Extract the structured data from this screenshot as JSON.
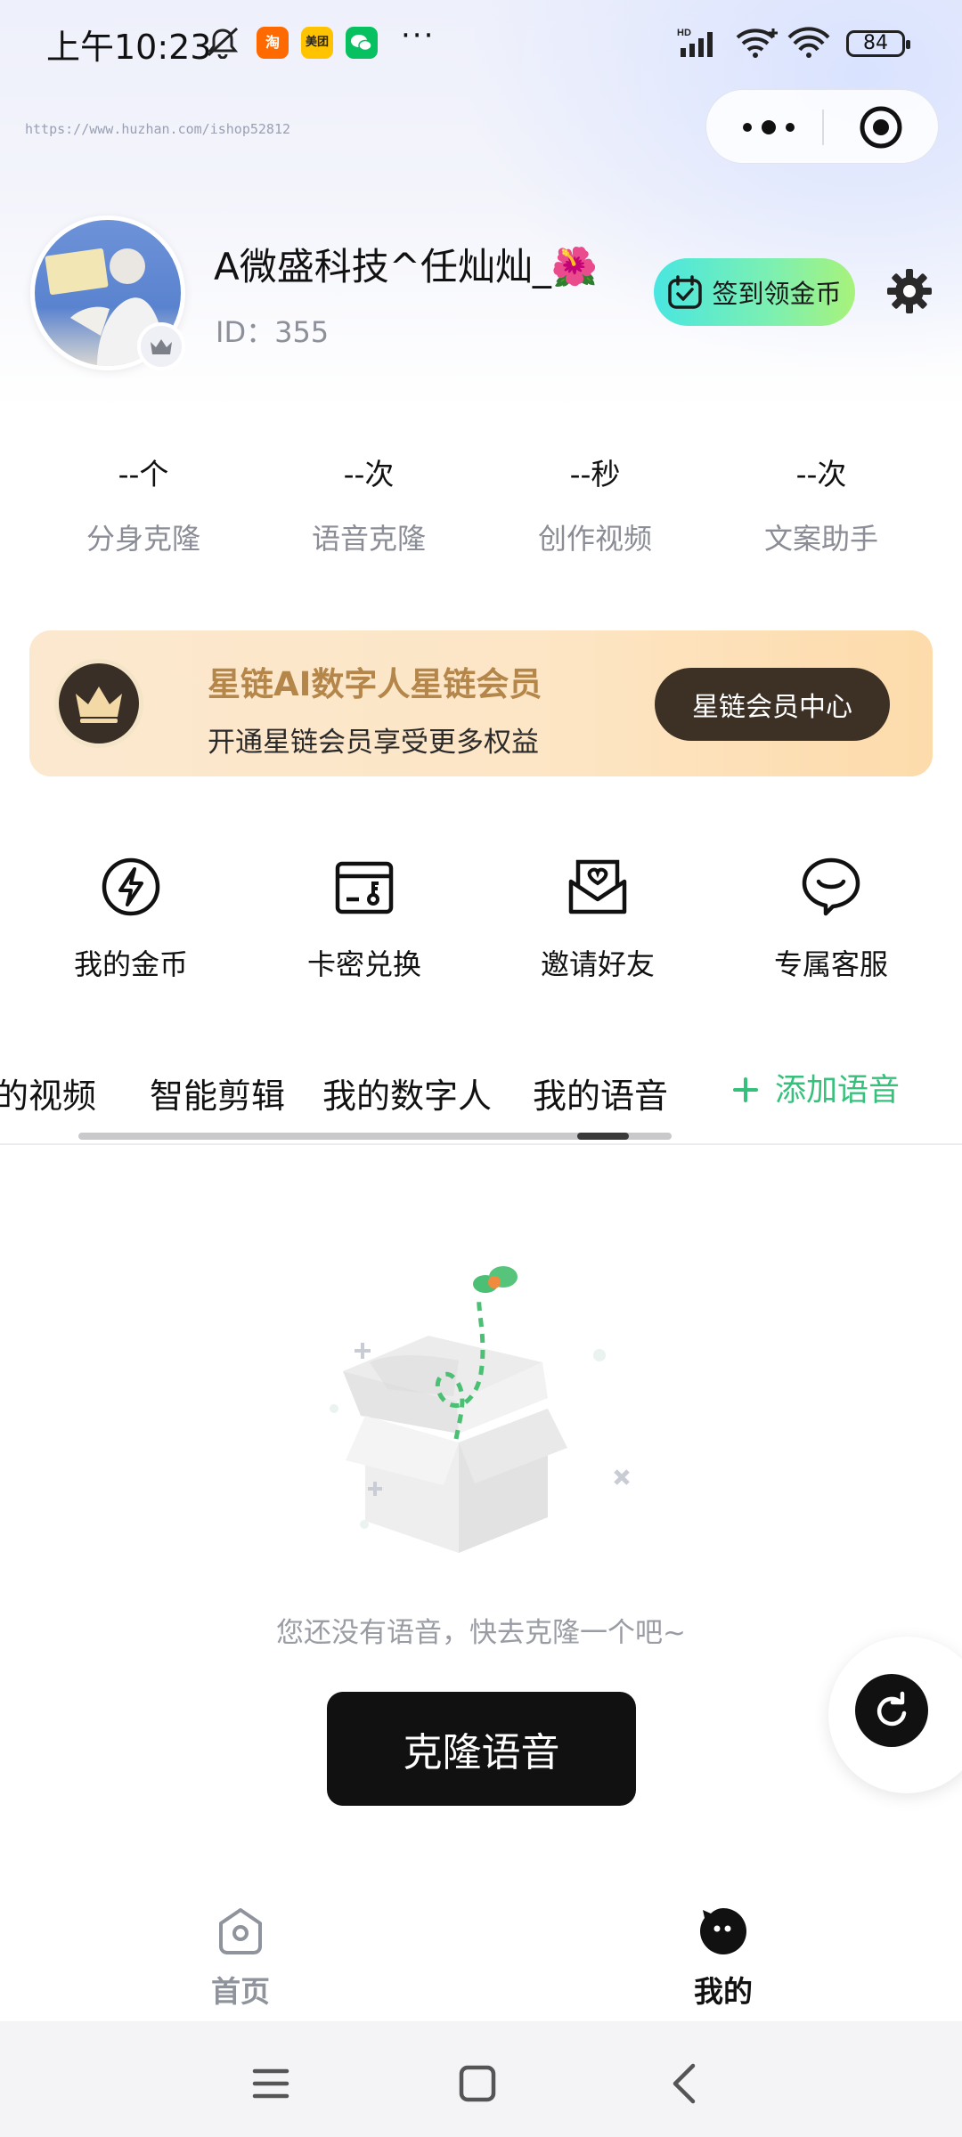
{
  "status_bar": {
    "time": "上午10:23",
    "apps": [
      {
        "name": "taobao",
        "label": "淘",
        "color": "#ff6a00"
      },
      {
        "name": "meituan",
        "label": "美团",
        "color": "#ffc300"
      },
      {
        "name": "wechat",
        "label": "",
        "color": "#07c160"
      }
    ],
    "more": "···",
    "network": "HD",
    "battery": "84"
  },
  "watermark_url": "https://www.huzhan.com/ishop52812",
  "profile": {
    "nickname": "A微盛科技^任灿灿_🌺",
    "id_text": "ID：355",
    "signin_label": "签到领金币"
  },
  "stats": [
    {
      "value": "--个",
      "label": "分身克隆"
    },
    {
      "value": "--次",
      "label": "语音克隆"
    },
    {
      "value": "--秒",
      "label": "创作视频"
    },
    {
      "value": "--次",
      "label": "文案助手"
    }
  ],
  "vip": {
    "title": "星链AI数字人星链会员",
    "subtitle": "开通星链会员享受更多权益",
    "button": "星链会员中心"
  },
  "quick_actions": [
    {
      "label": "我的金币",
      "icon": "lightning-icon"
    },
    {
      "label": "卡密兑换",
      "icon": "card-key-icon"
    },
    {
      "label": "邀请好友",
      "icon": "invite-envelope-icon"
    },
    {
      "label": "专属客服",
      "icon": "service-bubble-icon"
    }
  ],
  "tabs": [
    {
      "label": "的视频"
    },
    {
      "label": "智能剪辑"
    },
    {
      "label": "我的数字人"
    },
    {
      "label": "我的语音"
    }
  ],
  "add_voice": "添加语音",
  "empty": {
    "message": "您还没有语音，快去克隆一个吧~",
    "button": "克隆语音"
  },
  "bottom_nav": [
    {
      "label": "首页",
      "active": false
    },
    {
      "label": "我的",
      "active": true
    }
  ]
}
